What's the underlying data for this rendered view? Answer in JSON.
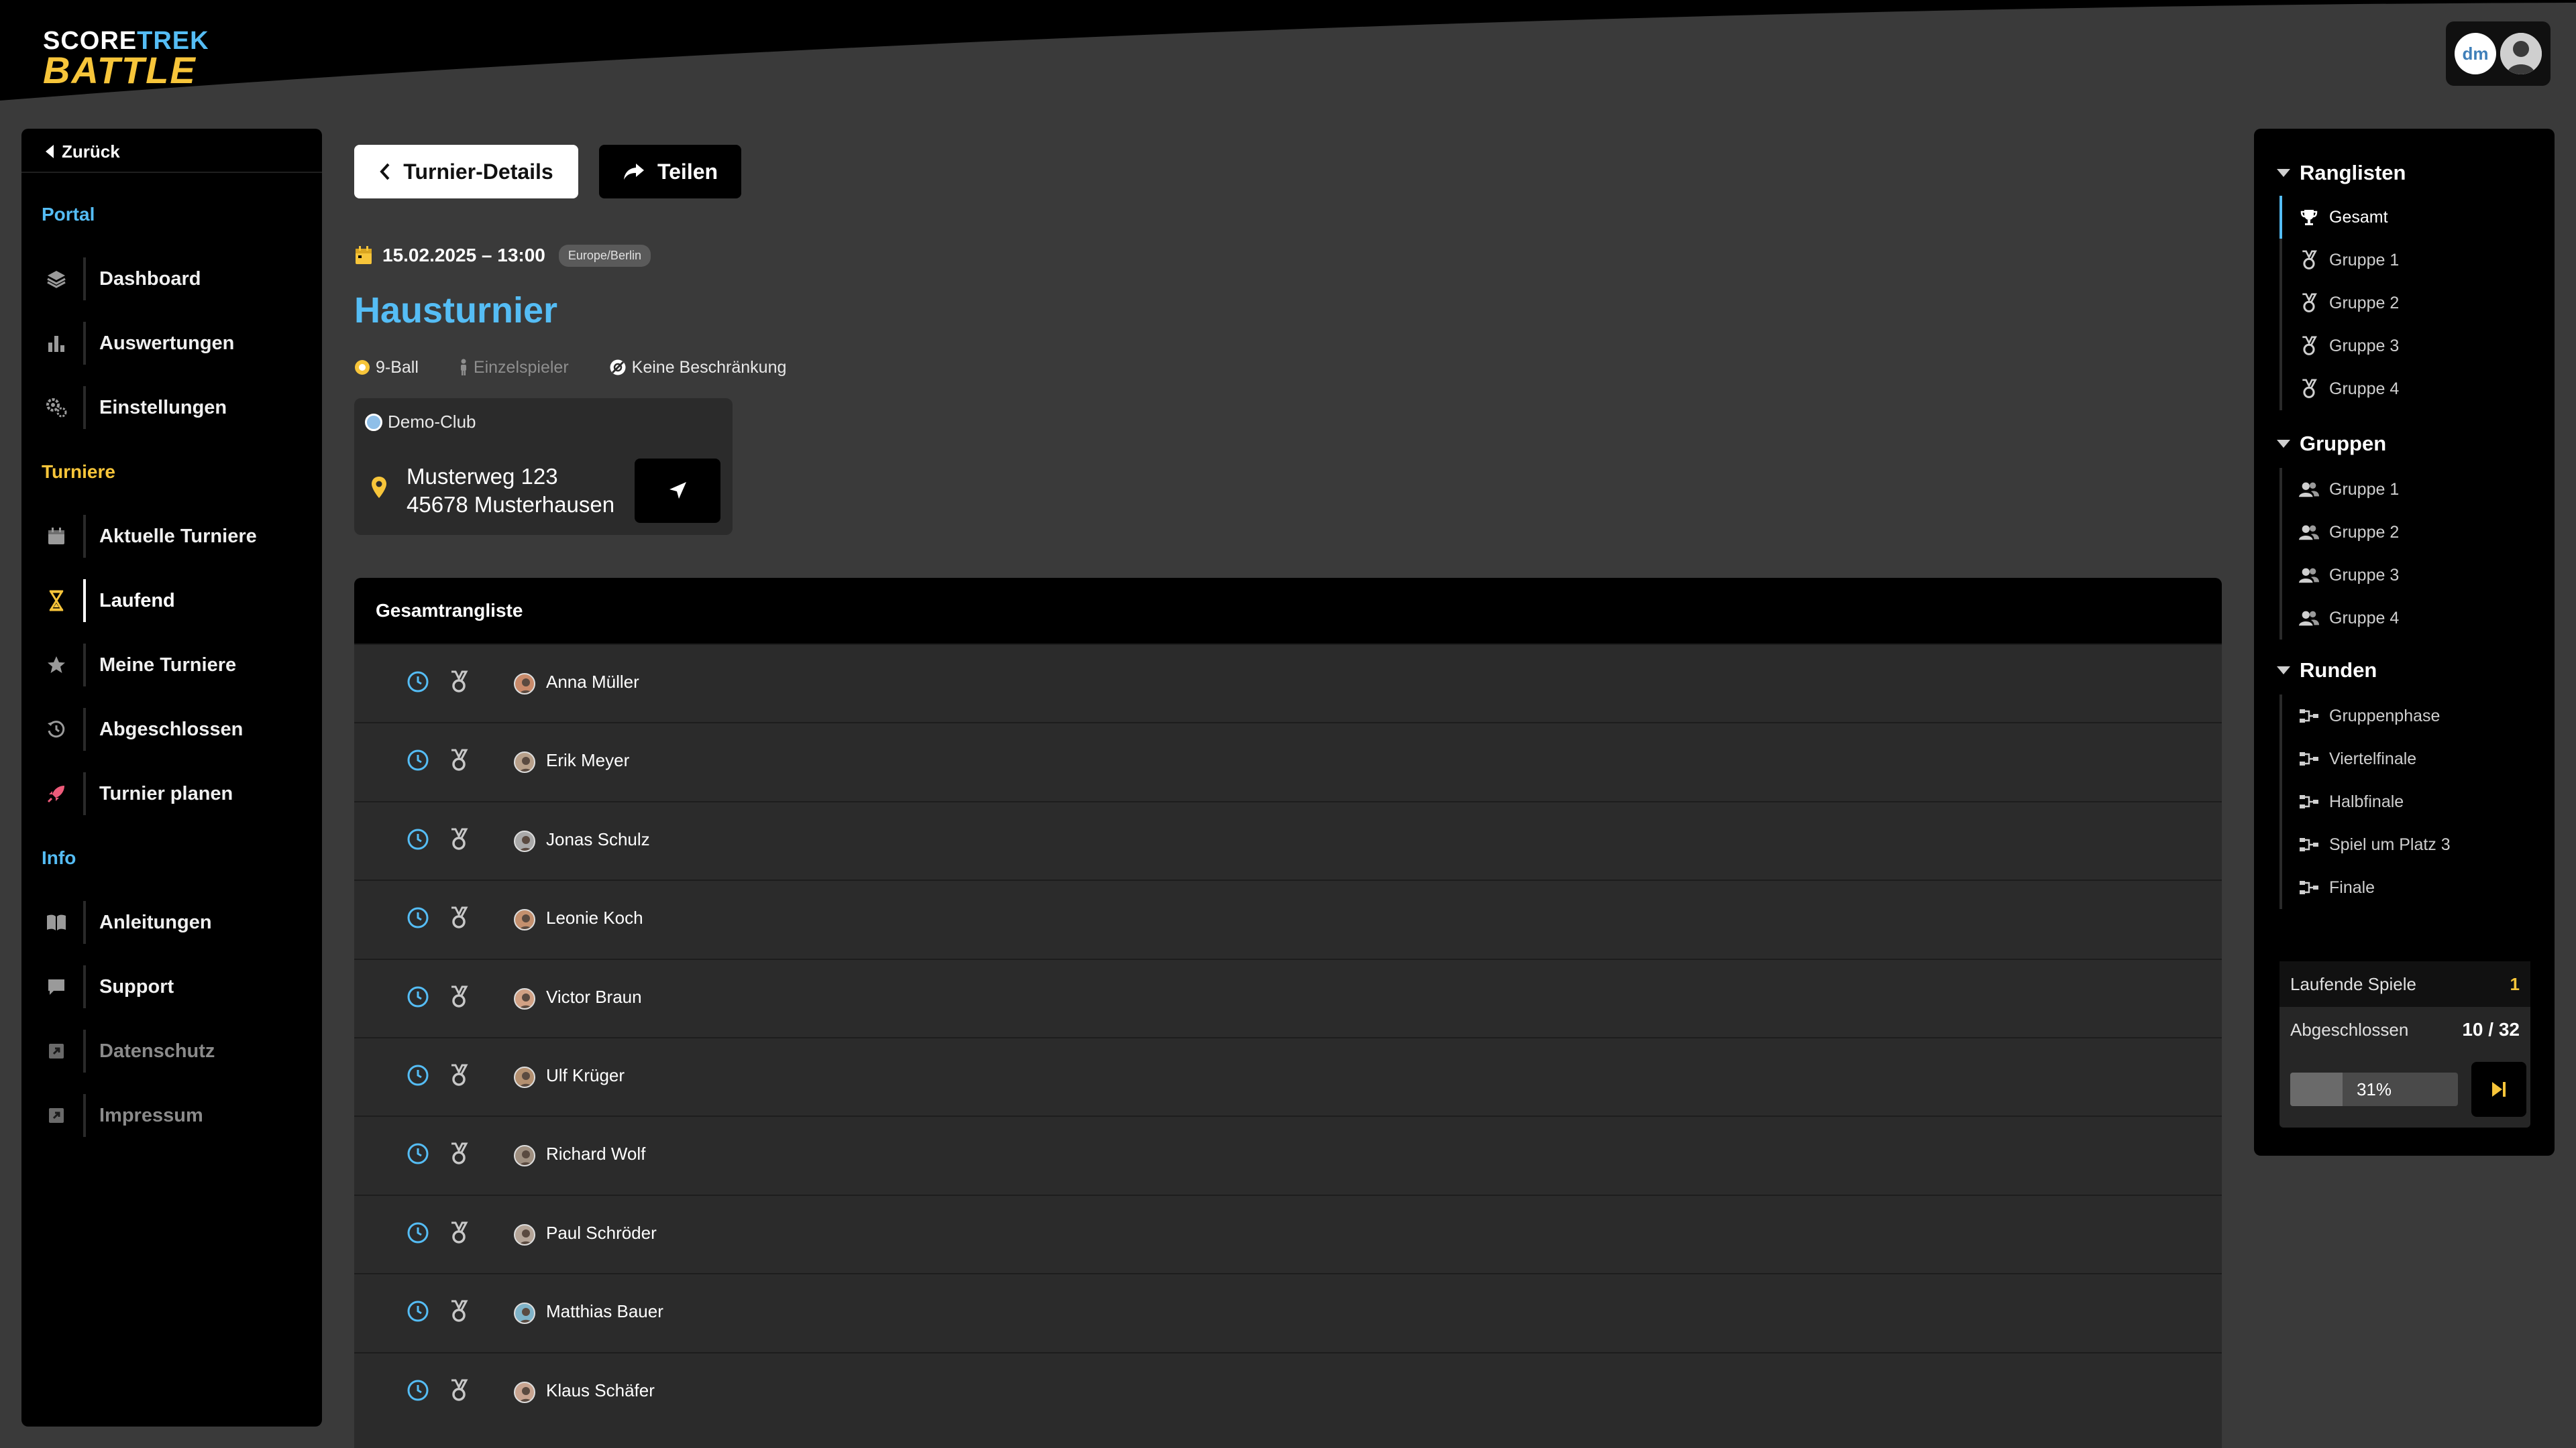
{
  "brand": {
    "line1_a": "SCORE",
    "line1_b": "TREK",
    "line2": "BATTLE"
  },
  "user": {
    "initials": "dm"
  },
  "sidebar": {
    "back_label": "Zurück",
    "sections": {
      "portal": "Portal",
      "turniere": "Turniere",
      "info": "Info"
    },
    "items": [
      {
        "label": "Dashboard",
        "icon": "layers-icon"
      },
      {
        "label": "Auswertungen",
        "icon": "bar-chart-icon"
      },
      {
        "label": "Einstellungen",
        "icon": "gears-icon"
      },
      {
        "label": "Aktuelle Turniere",
        "icon": "calendar-icon"
      },
      {
        "label": "Laufend",
        "icon": "hourglass-icon",
        "active": true
      },
      {
        "label": "Meine Turniere",
        "icon": "star-icon"
      },
      {
        "label": "Abgeschlossen",
        "icon": "history-icon"
      },
      {
        "label": "Turnier planen",
        "icon": "rocket-icon"
      },
      {
        "label": "Anleitungen",
        "icon": "book-icon"
      },
      {
        "label": "Support",
        "icon": "chat-icon"
      },
      {
        "label": "Datenschutz",
        "icon": "external-icon"
      },
      {
        "label": "Impressum",
        "icon": "external-icon"
      }
    ]
  },
  "main": {
    "details_button": "Turnier-Details",
    "share_button": "Teilen",
    "date": "15.02.2025 – 13:00",
    "timezone": "Europe/Berlin",
    "title": "Hausturnier",
    "meta": {
      "game": "9-Ball",
      "mode": "Einzelspieler",
      "restriction": "Keine Beschränkung"
    },
    "venue": {
      "club": "Demo-Club",
      "street": "Musterweg 123",
      "city": "45678 Musterhausen"
    },
    "ranking": {
      "title": "Gesamtrangliste",
      "players": [
        "Anna Müller",
        "Erik Meyer",
        "Jonas Schulz",
        "Leonie Koch",
        "Victor Braun",
        "Ulf Krüger",
        "Richard Wolf",
        "Paul Schröder",
        "Matthias Bauer",
        "Klaus Schäfer"
      ]
    }
  },
  "right_panel": {
    "ranglisten": {
      "title": "Ranglisten",
      "items": [
        "Gesamt",
        "Gruppe 1",
        "Gruppe 2",
        "Gruppe 3",
        "Gruppe 4"
      ]
    },
    "gruppen": {
      "title": "Gruppen",
      "items": [
        "Gruppe 1",
        "Gruppe 2",
        "Gruppe 3",
        "Gruppe 4"
      ]
    },
    "runden": {
      "title": "Runden",
      "items": [
        "Gruppenphase",
        "Viertelfinale",
        "Halbfinale",
        "Spiel um Platz 3",
        "Finale"
      ]
    },
    "stats": {
      "running_label": "Laufende Spiele",
      "running_value": "1",
      "done_label": "Abgeschlossen",
      "done_value": "10 / 32",
      "progress_label": "31%",
      "progress_fraction": 0.31
    }
  },
  "colors": {
    "accent_blue": "#55bdf5",
    "accent_yellow": "#f7c53a",
    "background": "#3a3a3a",
    "panel": "#000000"
  }
}
